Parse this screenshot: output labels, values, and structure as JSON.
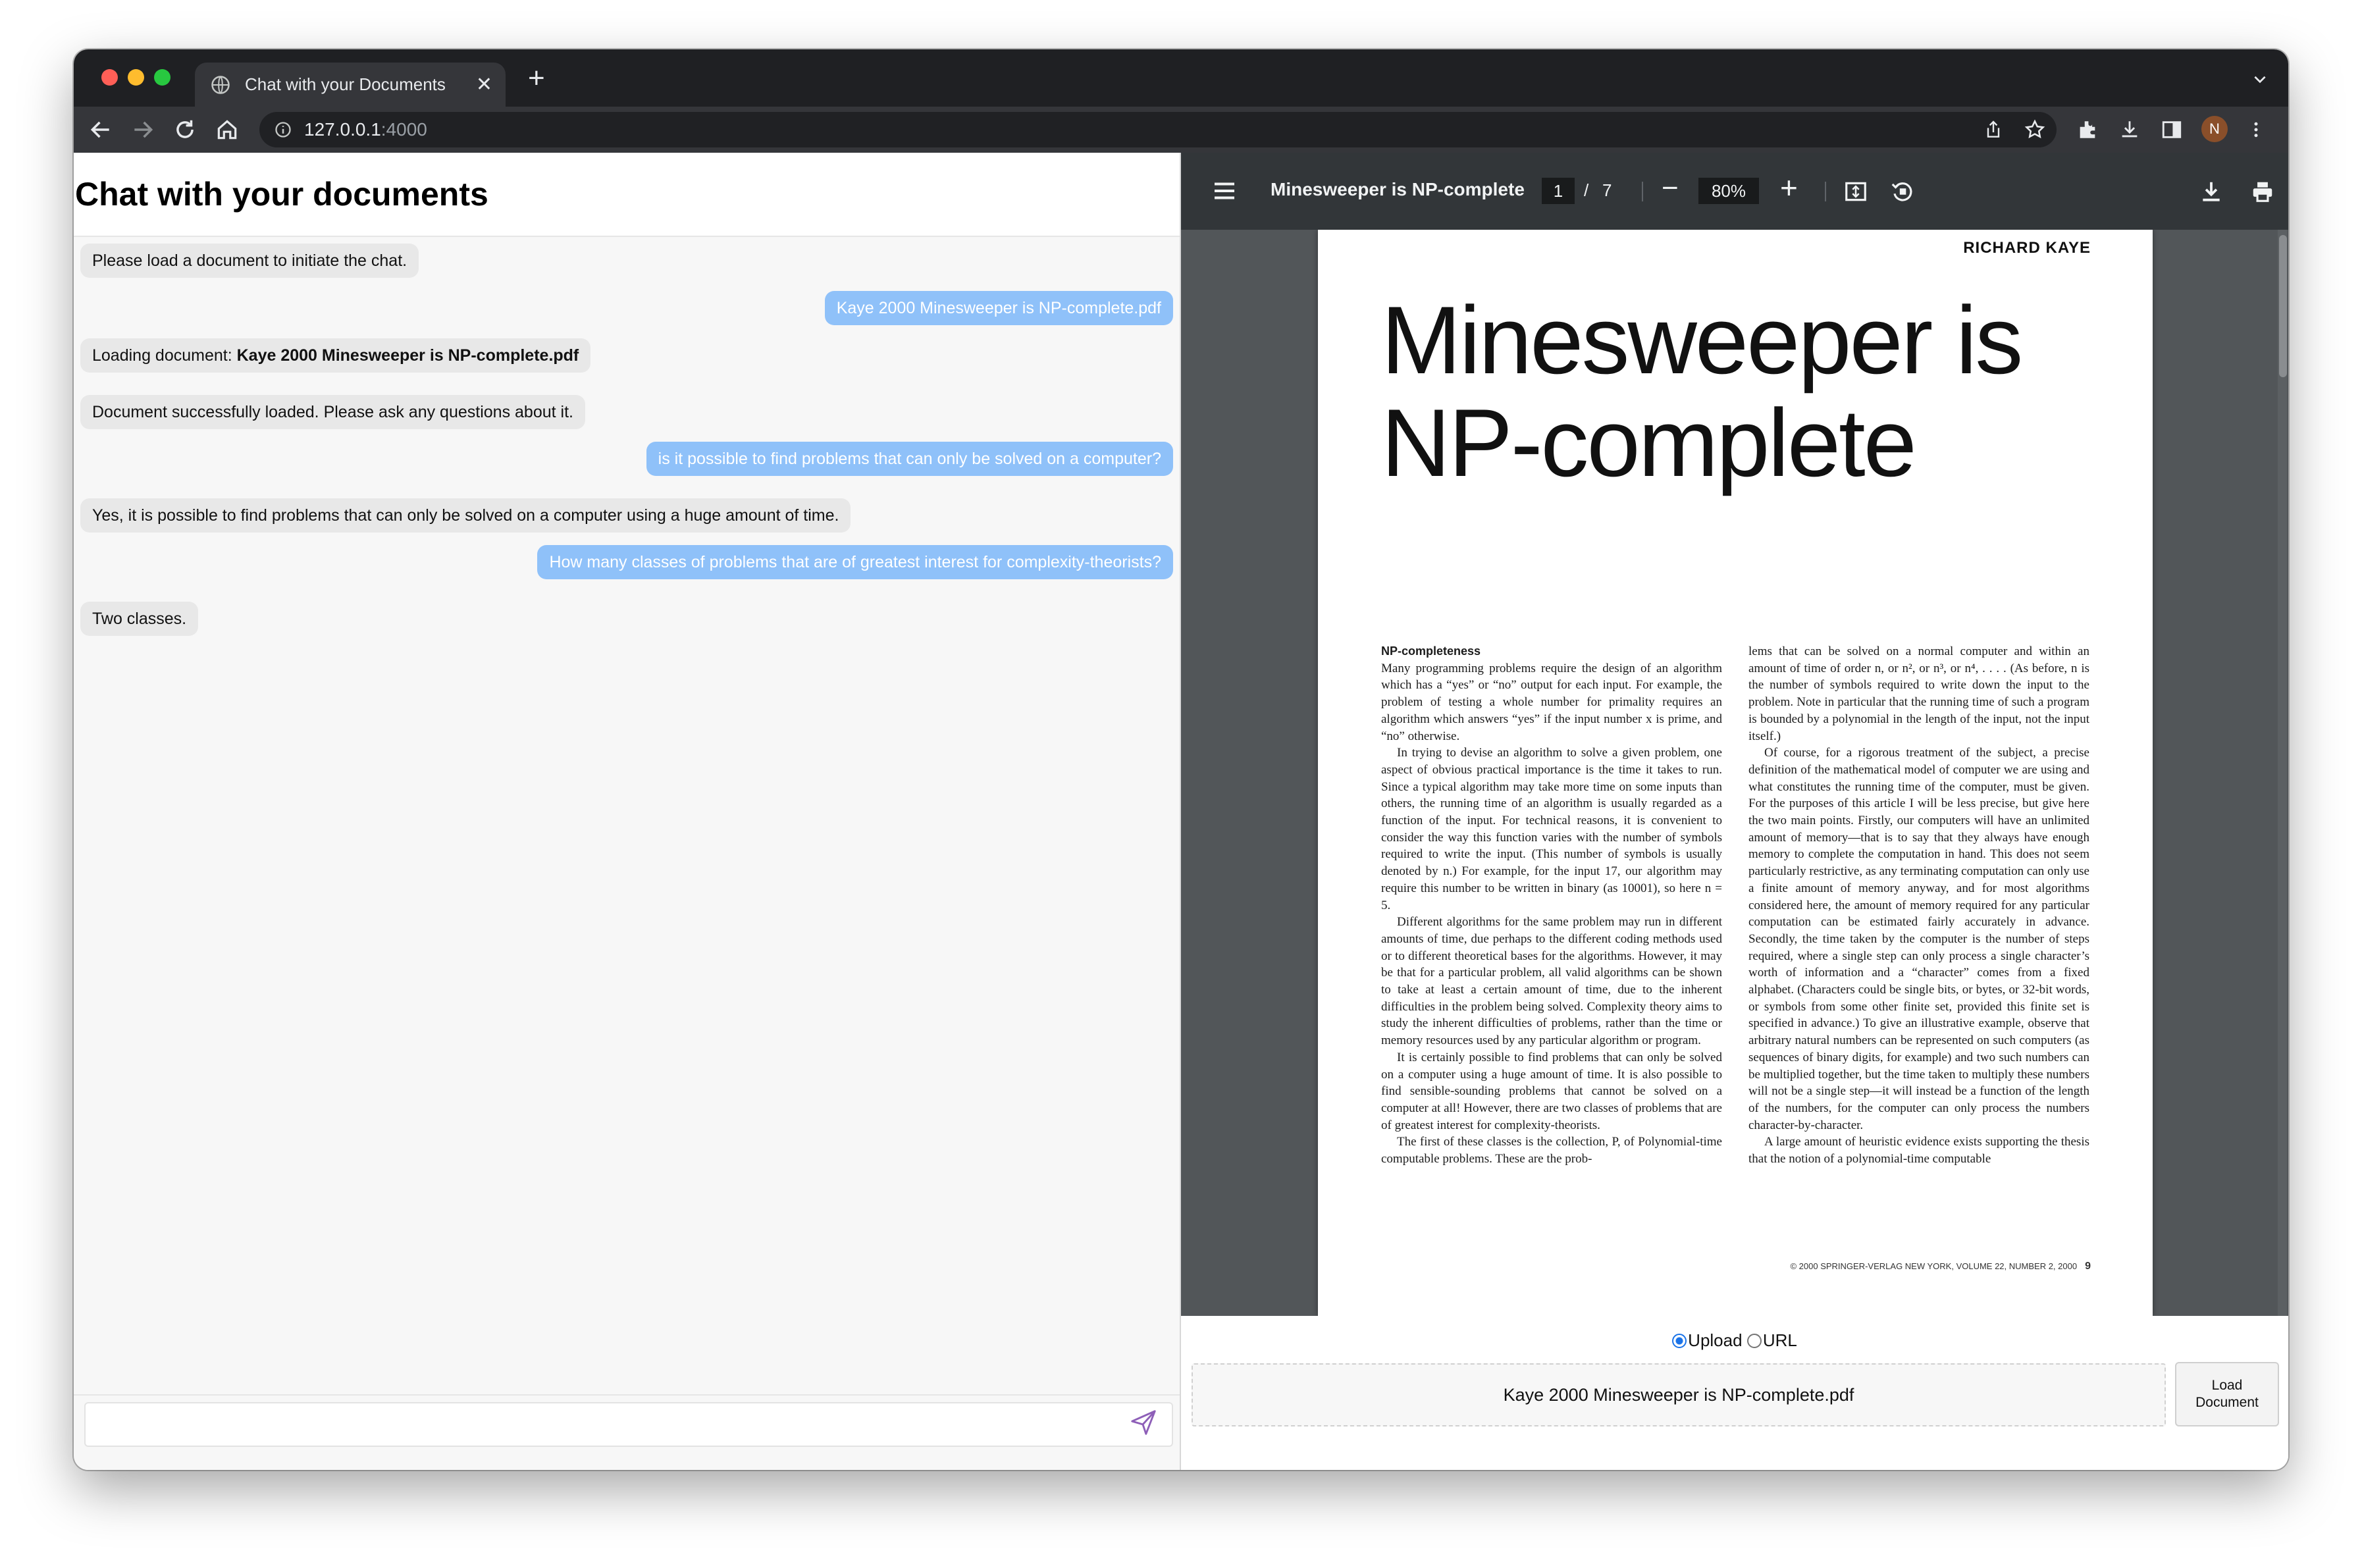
{
  "browser": {
    "tab_title": "Chat with your Documents",
    "url_host": "127.0.0.1",
    "url_port": ":4000",
    "profile_initial": "N"
  },
  "chat": {
    "title": "Chat with your documents",
    "messages": [
      {
        "role": "bot",
        "text": "Please load a document to initiate the chat."
      },
      {
        "role": "user",
        "text": "Kaye 2000 Minesweeper is NP-complete.pdf"
      },
      {
        "role": "bot",
        "prefix": "Loading document: ",
        "bold": "Kaye 2000 Minesweeper is NP-complete.pdf"
      },
      {
        "role": "bot",
        "text": "Document successfully loaded. Please ask any questions about it."
      },
      {
        "role": "user",
        "text": "is it possible to find problems that can only be solved on a computer?"
      },
      {
        "role": "bot",
        "text": "Yes, it is possible to find problems that can only be solved on a computer using a huge amount of time."
      },
      {
        "role": "user",
        "text": "How many classes of problems that are of greatest interest for complexity-theorists?"
      },
      {
        "role": "bot",
        "text": "Two classes."
      }
    ],
    "input_value": ""
  },
  "pdf": {
    "doc_title": "Minesweeper is NP-complete",
    "current_page": "1",
    "page_sep": "/",
    "total_pages": "7",
    "zoom": "80%",
    "page": {
      "author": "RICHARD KAYE",
      "title_line1": "Minesweeper is",
      "title_line2": "NP-complete",
      "section_heading": "NP-completeness",
      "left_paragraphs": [
        "Many programming problems require the design of an algorithm which has a “yes” or “no” output for each input. For example, the problem of testing a whole number for primality requires an algorithm which answers “yes” if the input number x is prime, and “no” otherwise.",
        "In trying to devise an algorithm to solve a given problem, one aspect of obvious practical importance is the time it takes to run. Since a typical algorithm may take more time on some inputs than others, the running time of an algorithm is usually regarded as a function of the input. For technical reasons, it is convenient to consider the way this function varies with the number of symbols required to write the input. (This number of symbols is usually denoted by n.) For example, for the input 17, our algorithm may require this number to be written in binary (as 10001), so here n = 5.",
        "Different algorithms for the same problem may run in different amounts of time, due perhaps to the different coding methods used or to different theoretical bases for the algorithms. However, it may be that for a particular problem, all valid algorithms can be shown to take at least a certain amount of time, due to the inherent difficulties in the problem being solved. Complexity theory aims to study the inherent difficulties of problems, rather than the time or memory resources used by any particular algorithm or program.",
        "It is certainly possible to find problems that can only be solved on a computer using a huge amount of time. It is also possible to find sensible-sounding problems that cannot be solved on a computer at all! However, there are two classes of problems that are of greatest interest for complexity-theorists.",
        "The first of these classes is the collection, P, of Polynomial-time computable problems. These are the prob-"
      ],
      "right_paragraphs": [
        "lems that can be solved on a normal computer and within an amount of time of order n, or n², or n³, or n⁴, . . . . (As before, n is the number of symbols required to write down the input to the problem. Note in particular that the running time of such a program is bounded by a polynomial in the length of the input, not the input itself.)",
        "Of course, for a rigorous treatment of the subject, a precise definition of the mathematical model of computer we are using and what constitutes the running time of the computer, must be given. For the purposes of this article I will be less precise, but give here the two main points. Firstly, our computers will have an unlimited amount of memory—that is to say that they always have enough memory to complete the computation in hand. This does not seem particularly restrictive, as any terminating computation can only use a finite amount of memory anyway, and for most algorithms considered here, the amount of memory required for any particular computation can be estimated fairly accurately in advance. Secondly, the time taken by the computer is the number of steps required, where a single step can only process a single character’s worth of information and a “character” comes from a fixed alphabet. (Characters could be single bits, or bytes, or 32-bit words, or symbols from some other finite set, provided this finite set is specified in advance.) To give an illustrative example, observe that arbitrary natural numbers can be represented on such computers (as sequences of binary digits, for example) and two such numbers can be multiplied together, but the time taken to multiply these numbers will not be a single step—it will instead be a function of the length of the numbers, for the computer can only process the numbers character-by-character.",
        "A large amount of heuristic evidence exists supporting the thesis that the notion of a polynomial-time computable"
      ],
      "footer": "© 2000 SPRINGER-VERLAG NEW YORK, VOLUME 22, NUMBER 2, 2000",
      "page_number": "9"
    }
  },
  "loader": {
    "radio_upload": "Upload",
    "radio_url": "URL",
    "selected_mode": "Upload",
    "file_name": "Kaye 2000 Minesweeper is NP-complete.pdf",
    "load_button_line1": "Load",
    "load_button_line2": "Document"
  },
  "colors": {
    "user_bubble": "#8fc1f9",
    "bot_bubble": "#e8e8e8",
    "pdf_toolbar": "#323639",
    "pdf_background": "#525659"
  }
}
